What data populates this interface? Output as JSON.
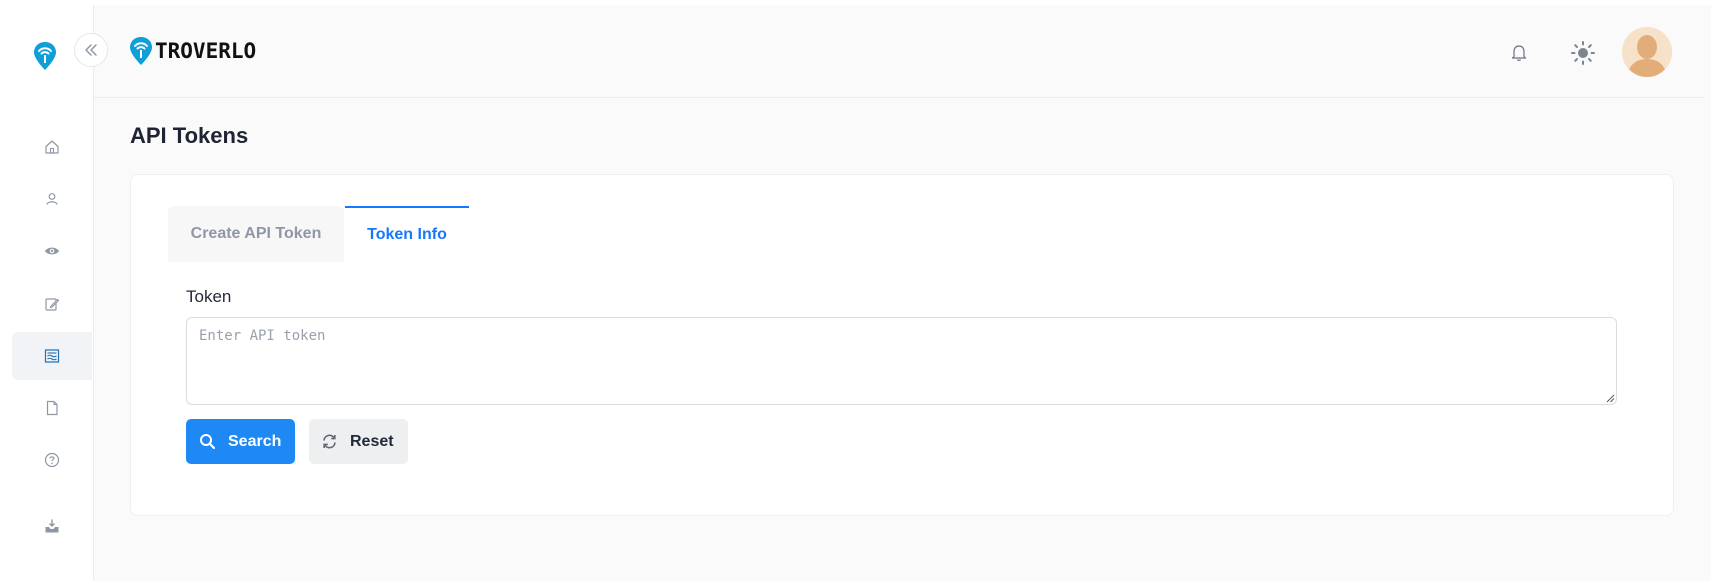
{
  "brand": {
    "name": "TROVERLO"
  },
  "sidebar": {
    "items": [
      {
        "name": "home-icon"
      },
      {
        "name": "user-icon"
      },
      {
        "name": "eye-icon"
      },
      {
        "name": "edit-icon"
      },
      {
        "name": "api-tokens-icon",
        "active": true
      },
      {
        "name": "file-icon"
      },
      {
        "name": "help-icon"
      },
      {
        "name": "download-icon"
      }
    ]
  },
  "header": {
    "icons": [
      "bell-icon",
      "sun-icon",
      "avatar"
    ]
  },
  "page": {
    "title": "API Tokens"
  },
  "tabs": [
    {
      "label": "Create API Token",
      "active": false
    },
    {
      "label": "Token Info",
      "active": true
    }
  ],
  "form": {
    "token_label": "Token",
    "token_placeholder": "Enter API token",
    "token_value": "",
    "search_label": "Search",
    "reset_label": "Reset"
  },
  "colors": {
    "accent": "#1677ff",
    "button_primary": "#1e88f5",
    "brand_teal": "#0e9fd8"
  }
}
